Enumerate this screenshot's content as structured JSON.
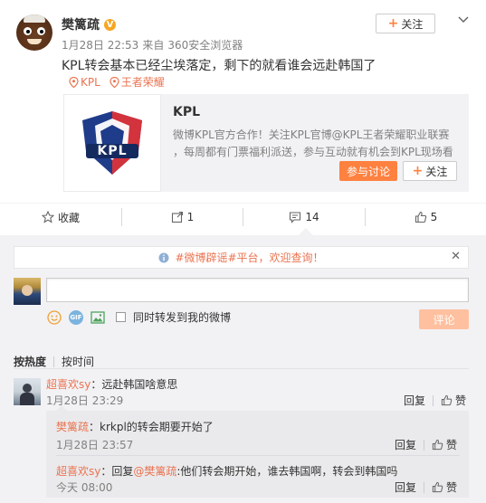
{
  "post": {
    "author": "樊篱疏",
    "time": "1月28日 22:53",
    "source_prefix": "来自",
    "source": "360安全浏览器",
    "follow_label": "关注",
    "text": "KPL转会基本已经尘埃落定，剩下的就看谁会远赴韩国了",
    "tags": [
      "KPL",
      "王者荣耀"
    ]
  },
  "card": {
    "logo_text": "KPL",
    "title": "KPL",
    "desc_line1": "微博KPL官方合作！关注KPL官博@KPL王者荣耀职业联赛",
    "desc_line2": "，每周都有门票福利派送，参与互动就有机会到KPL现场看",
    "discuss_label": "参与讨论",
    "follow_label": "关注"
  },
  "actions": {
    "favorite": "收藏",
    "repost": "1",
    "comment": "14",
    "like": "5"
  },
  "notice": {
    "text": "#微博辟谣#平台，欢迎查询！"
  },
  "composer": {
    "placeholder": "",
    "also_repost": "同时转发到我的微博",
    "submit": "评论"
  },
  "sort": {
    "by_heat": "按热度",
    "by_time": "按时间"
  },
  "comments": [
    {
      "user": "超喜欢sy",
      "text": "：远赴韩国啥意思",
      "time": "1月28日 23:29",
      "reply_label": "回复",
      "like_label": "赞",
      "replies": [
        {
          "user": "樊篱疏",
          "text": "：krkpl的转会期要开始了",
          "time": "1月28日 23:57",
          "reply_label": "回复",
          "like_label": "赞"
        },
        {
          "user": "超喜欢sy",
          "text_prefix": "：回复",
          "mention": "@樊篱疏",
          "text": ":他们转会期开始，谁去韩国啊，转会到韩国吗",
          "time": "今天 08:00",
          "reply_label": "回复",
          "like_label": "赞"
        }
      ]
    }
  ],
  "colors": {
    "accent": "#eb7350",
    "link": "#eb7350",
    "submit_disabled": "#ffc09f",
    "discuss_btn": "#ff8140"
  }
}
